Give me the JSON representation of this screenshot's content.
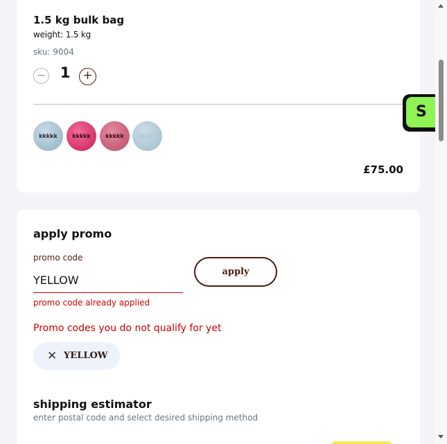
{
  "product": {
    "title": "1.5 kg bulk bag",
    "weight": "weight: 1.5 kg",
    "sku": "sku: 9004",
    "quantity": "1",
    "minus_symbol": "−",
    "plus_symbol": "+",
    "swatches": [
      {
        "label": "kkkkk",
        "color": "#a9c6d5"
      },
      {
        "label": "kkkkk",
        "color": "#e03a75"
      },
      {
        "label": "kkkkk",
        "color": "#cd6a82"
      },
      {
        "label": "kkkkk",
        "color": "#aac7d6"
      }
    ],
    "price": "£75.00"
  },
  "promo": {
    "heading": "apply promo",
    "field_label": "promo code",
    "value": "YELLOW",
    "apply_label": "apply",
    "error": "promo code already applied",
    "not_qualify": "Promo codes you do not qualify for yet",
    "chip_close_symbol": "✕",
    "chip_label": "YELLOW"
  },
  "shipping": {
    "heading": "shipping estimator",
    "description": "enter postal code and select desired shipping method"
  },
  "sticker": {
    "letter": "S",
    "color": "#8ff255"
  },
  "colors": {
    "accent_brown": "#4a1e0e",
    "error_red": "#cc0000",
    "page_bg": "#f3f3f8"
  }
}
